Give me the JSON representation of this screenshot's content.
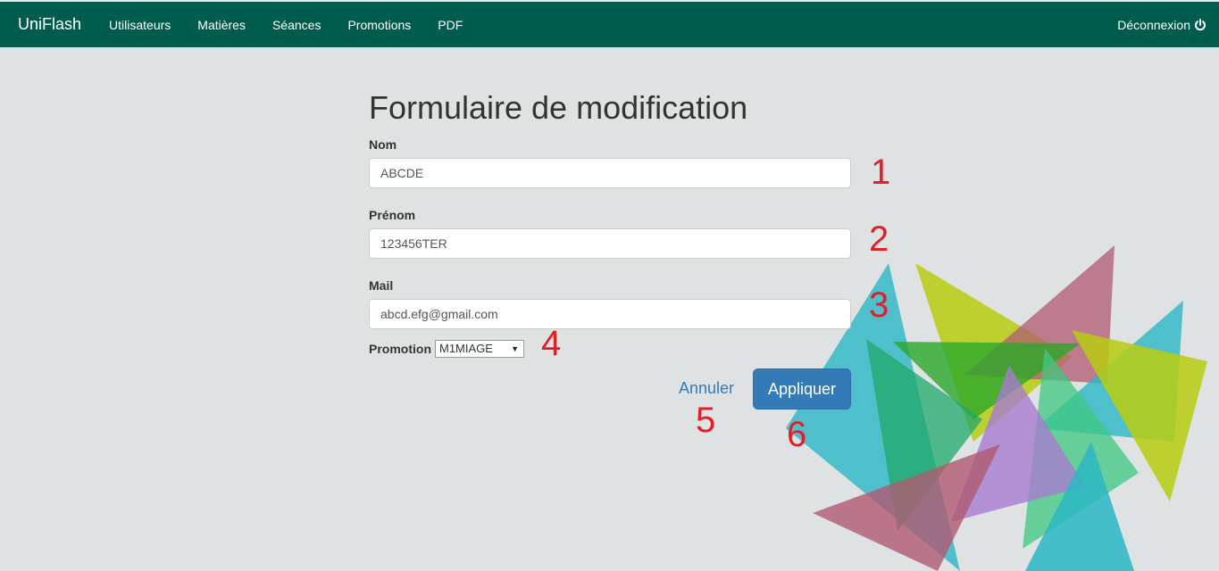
{
  "navbar": {
    "brand": "UniFlash",
    "links": [
      "Utilisateurs",
      "Matières",
      "Séances",
      "Promotions",
      "PDF"
    ],
    "logout_label": "Déconnexion"
  },
  "form": {
    "title": "Formulaire de modification",
    "nom_label": "Nom",
    "nom_value": "ABCDE",
    "prenom_label": "Prénom",
    "prenom_value": "123456TER",
    "mail_label": "Mail",
    "mail_value": "abcd.efg@gmail.com",
    "promotion_label": "Promotion",
    "promotion_value": "M1MIAGE",
    "cancel_label": "Annuler",
    "apply_label": "Appliquer"
  },
  "annotations": [
    "1",
    "2",
    "3",
    "4",
    "5",
    "6"
  ],
  "colors": {
    "navbar": "#005c4c",
    "background": "#dfe2e3",
    "primary": "#337ab7",
    "annotation": "#e01f26"
  }
}
